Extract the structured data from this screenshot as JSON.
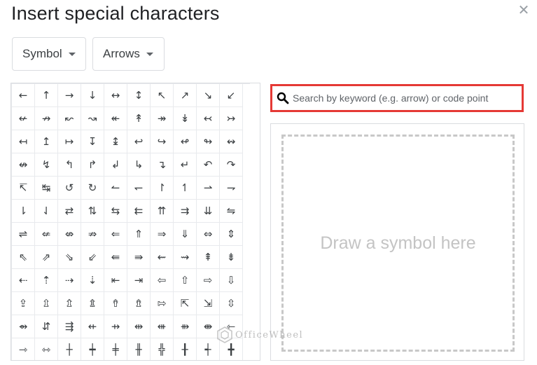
{
  "dialog": {
    "title": "Insert special characters",
    "close_icon": "close-icon"
  },
  "filters": {
    "category": "Symbol",
    "subcategory": "Arrows"
  },
  "search": {
    "icon": "search-icon",
    "placeholder": "Search by keyword (e.g. arrow) or code point",
    "value": ""
  },
  "draw": {
    "hint": "Draw a symbol here"
  },
  "watermark": {
    "text": "OfficeWheel"
  },
  "symbols": [
    [
      "←",
      "↑",
      "→",
      "↓",
      "↔",
      "↕",
      "↖",
      "↗",
      "↘",
      "↙"
    ],
    [
      "↚",
      "↛",
      "↜",
      "↝",
      "↞",
      "↟",
      "↠",
      "↡",
      "↢",
      "↣"
    ],
    [
      "↤",
      "↥",
      "↦",
      "↧",
      "↨",
      "↩",
      "↪",
      "↫",
      "↬",
      "↭"
    ],
    [
      "↮",
      "↯",
      "↰",
      "↱",
      "↲",
      "↳",
      "↴",
      "↵",
      "↶",
      "↷"
    ],
    [
      "↸",
      "↹",
      "↺",
      "↻",
      "↼",
      "↽",
      "↾",
      "↿",
      "⇀",
      "⇁"
    ],
    [
      "⇂",
      "⇃",
      "⇄",
      "⇅",
      "⇆",
      "⇇",
      "⇈",
      "⇉",
      "⇊",
      "⇋"
    ],
    [
      "⇌",
      "⇍",
      "⇎",
      "⇏",
      "⇐",
      "⇑",
      "⇒",
      "⇓",
      "⇔",
      "⇕"
    ],
    [
      "⇖",
      "⇗",
      "⇘",
      "⇙",
      "⇚",
      "⇛",
      "⇜",
      "⇝",
      "⇞",
      "⇟"
    ],
    [
      "⇠",
      "⇡",
      "⇢",
      "⇣",
      "⇤",
      "⇥",
      "⇦",
      "⇧",
      "⇨",
      "⇩"
    ],
    [
      "⇪",
      "⇫",
      "⇬",
      "⇭",
      "⇮",
      "⇯",
      "⇰",
      "⇱",
      "⇲",
      "⇳"
    ],
    [
      "⇴",
      "⇵",
      "⇶",
      "⇷",
      "⇸",
      "⇹",
      "⇺",
      "⇻",
      "⇼",
      "⇽"
    ],
    [
      "⇾",
      "⇿",
      "┼",
      "┿",
      "╪",
      "╫",
      "╬",
      "╂",
      "┽",
      "╋"
    ]
  ]
}
